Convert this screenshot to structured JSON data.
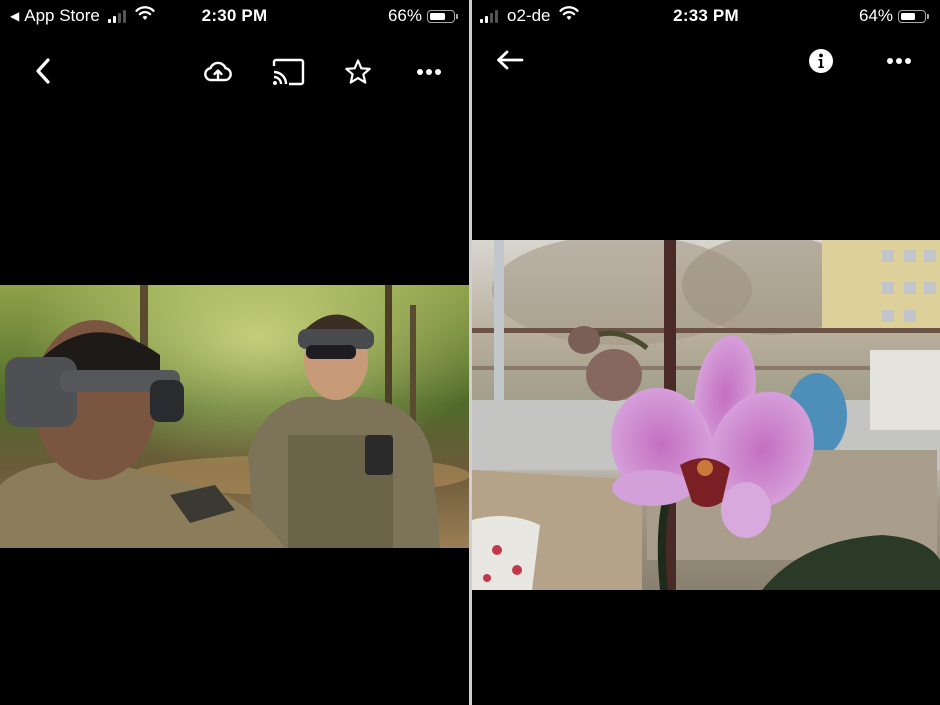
{
  "left_screen": {
    "status_bar": {
      "back_app_label": "App Store",
      "time": "2:30 PM",
      "battery_percent_label": "66%",
      "battery_level": 0.66,
      "signal_bars_active": 2,
      "signal_bars_total": 4
    },
    "toolbar": {
      "back_icon": "chevron-left",
      "actions": [
        {
          "name": "upload-to-cloud",
          "icon": "cloud-upload"
        },
        {
          "name": "cast",
          "icon": "cast"
        },
        {
          "name": "favorite",
          "icon": "star-outline"
        },
        {
          "name": "more",
          "icon": "more-horizontal"
        }
      ]
    },
    "photo": {
      "description": "Two soldiers in camouflage wearing mixed-reality headsets in a forest by a stream"
    }
  },
  "right_screen": {
    "status_bar": {
      "carrier": "o2-de",
      "time": "2:33 PM",
      "battery_percent_label": "64%",
      "battery_level": 0.64,
      "signal_bars_active": 2,
      "signal_bars_total": 4
    },
    "toolbar": {
      "back_icon": "arrow-left",
      "actions": [
        {
          "name": "info",
          "icon": "info-circle"
        },
        {
          "name": "more",
          "icon": "more-horizontal"
        }
      ]
    },
    "photo": {
      "description": "Pink phalaenopsis orchid in front of a blurred balcony and apartment building"
    }
  }
}
